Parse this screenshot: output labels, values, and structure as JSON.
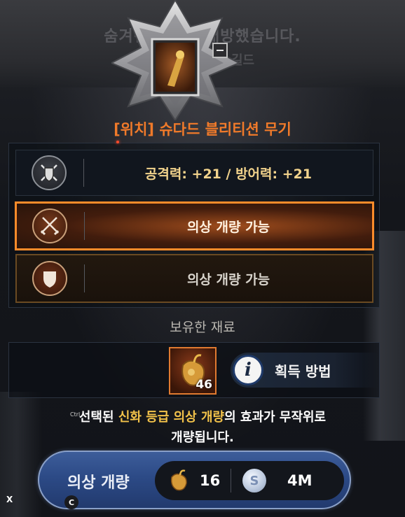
{
  "background": {
    "notice": "숨겨진 옵션을 개방했습니다.",
    "guild": "길드"
  },
  "item": {
    "title": "[위치] 슈다드 블리티션 무기"
  },
  "options": [
    {
      "icon": "shield-swords-icon",
      "text": "공격력: +21 / 방어력: +21",
      "state": "stat"
    },
    {
      "icon": "crossed-swords-icon",
      "text": "의상 개량 가능",
      "state": "selected"
    },
    {
      "icon": "shield-icon",
      "text": "의상 개량 가능",
      "state": "option"
    }
  ],
  "materials": {
    "label": "보유한 재료",
    "owned_count": "46",
    "how_to_get_label": "획득 방법"
  },
  "description": {
    "line1_prefix": "선택된 ",
    "line1_highlight": "신화 등급 의상 개량",
    "line1_suffix": "의 효과가 무작위로",
    "line2": "개량됩니다."
  },
  "badges": {
    "ctrl": "Ctrl",
    "x_key": "X",
    "c_key": "C"
  },
  "action": {
    "label": "의상 개량",
    "material_cost": "16",
    "silver_cost": "4M",
    "silver_symbol": "S"
  },
  "colors": {
    "accent_orange": "#ff8c2a",
    "title_orange": "#f07a2a",
    "highlight_gold": "#f2c24a",
    "button_blue": "#2c4a86"
  }
}
